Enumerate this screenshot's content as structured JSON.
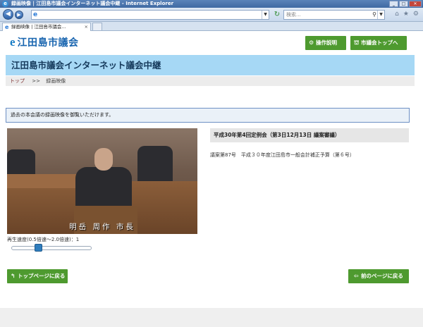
{
  "window": {
    "title": "録画映像 | 江田島市議会インターネット議会中継 - Internet Explorer",
    "address_icon": "e",
    "search_placeholder": "検索..."
  },
  "tabs": [
    {
      "label": "録画映像 | 江田島市議会...",
      "close": "×"
    }
  ],
  "header": {
    "logo_mark": "e",
    "logo_text": "江田島市議会",
    "buttons": {
      "manual": "操作説明",
      "council_top": "市議会トップへ"
    }
  },
  "banner": {
    "title": "江田島市議会インターネット議会中継"
  },
  "breadcrumb": {
    "home": "トップ",
    "separator": ">>",
    "current": "録画映像"
  },
  "notice": "過去の本会議の録画映像を御覧いただけます。",
  "video": {
    "caption": "明岳 周作 市長",
    "speed_label": "再生速度(0.5倍速～2.0倍速)：1",
    "speed_value": 1
  },
  "meeting": {
    "title": "平成30年第4回定例会（第3日12月13日 議案審議）",
    "agenda": "議案第87号　平成３０年度江田島市一般会計補正予算（第６号）"
  },
  "nav": {
    "back_top": "トップページに戻る",
    "prev_page": "前のページに戻る"
  },
  "colors": {
    "accent_green": "#4e9a2f",
    "banner_blue": "#a6d8f5",
    "logo_blue": "#1a66b0"
  }
}
